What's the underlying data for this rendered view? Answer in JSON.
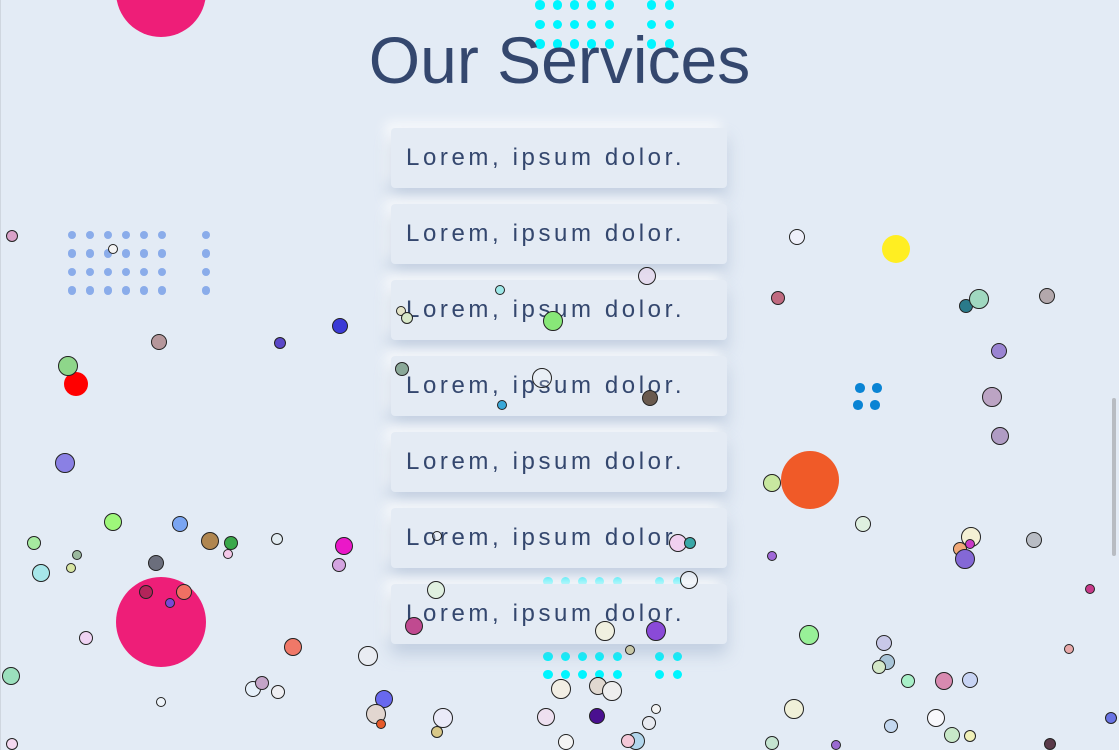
{
  "page": {
    "title": "Our Services"
  },
  "services": [
    {
      "label": "Lorem, ipsum dolor."
    },
    {
      "label": "Lorem, ipsum dolor."
    },
    {
      "label": "Lorem, ipsum dolor."
    },
    {
      "label": "Lorem, ipsum dolor."
    },
    {
      "label": "Lorem, ipsum dolor."
    },
    {
      "label": "Lorem, ipsum dolor."
    },
    {
      "label": "Lorem, ipsum dolor."
    }
  ],
  "colors": {
    "background": "#e3ebf5",
    "heading": "#34476e",
    "accent_pink": "#ee1e78",
    "accent_orange": "#f05a28",
    "accent_yellow": "#ffee22",
    "accent_cyan": "#00f5ff",
    "accent_blue_dots": "#8aacea",
    "accent_red": "#ff0000"
  }
}
